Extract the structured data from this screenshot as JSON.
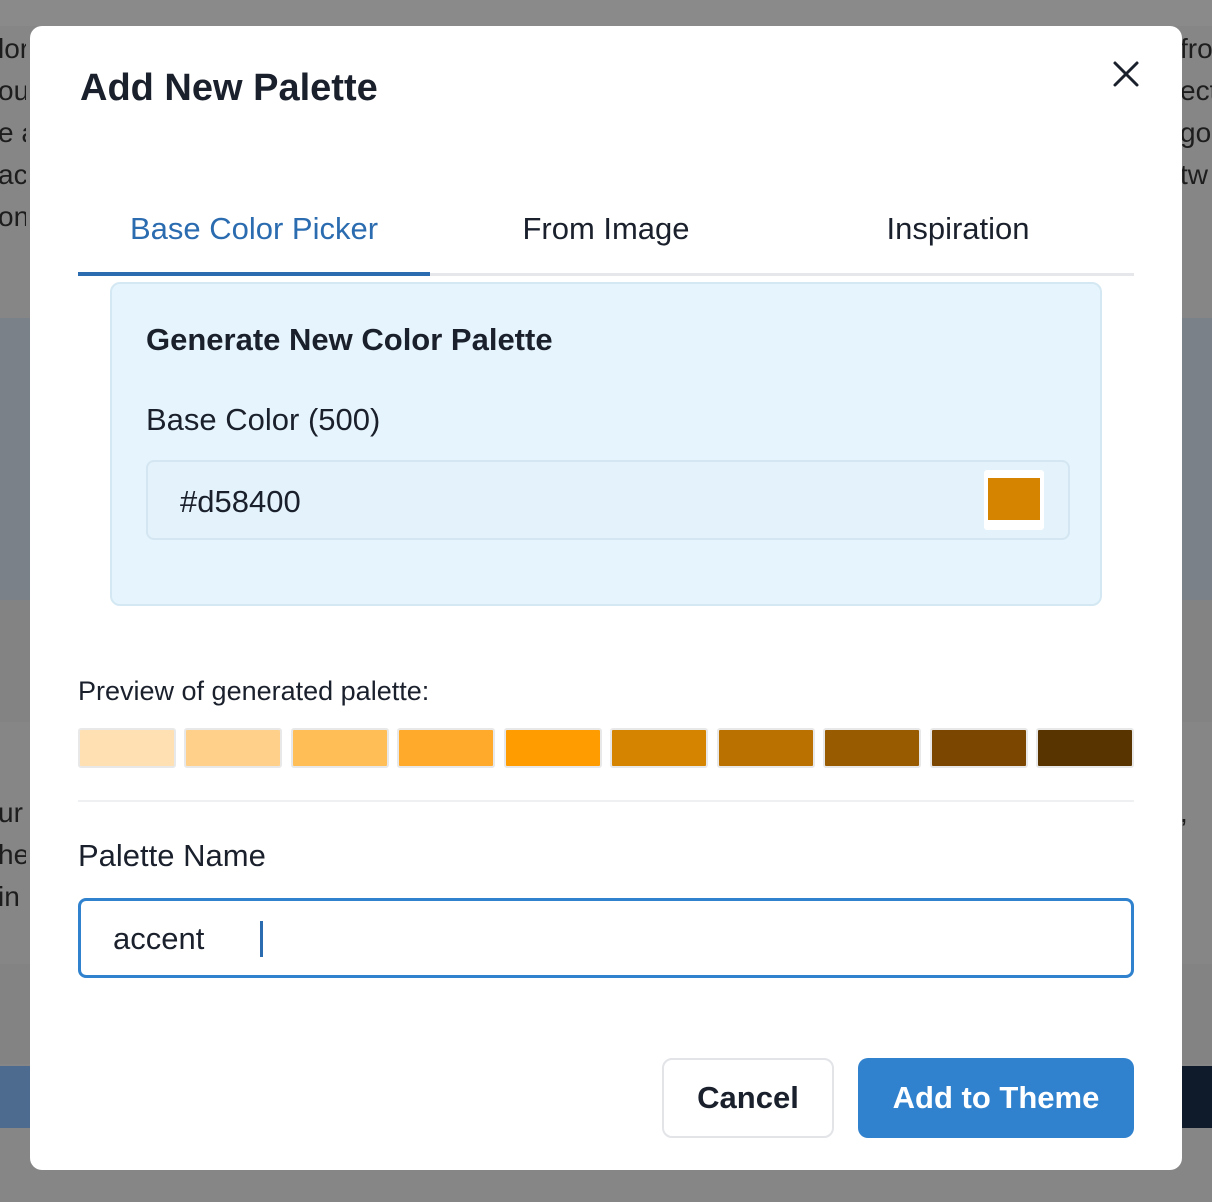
{
  "modal": {
    "title": "Add New Palette",
    "tabs": [
      {
        "label": "Base Color Picker",
        "active": true
      },
      {
        "label": "From Image",
        "active": false
      },
      {
        "label": "Inspiration",
        "active": false
      }
    ]
  },
  "generator": {
    "heading": "Generate New Color Palette",
    "base_color_label": "Base Color (500)",
    "base_color_value": "#d58400",
    "base_color_swatch": "#d58400"
  },
  "preview": {
    "label": "Preview of generated palette:",
    "swatches": [
      "#ffe0b2",
      "#ffd08a",
      "#ffbf56",
      "#ffaa2b",
      "#ff9c00",
      "#d58400",
      "#bb7100",
      "#985b00",
      "#7a4600",
      "#583400"
    ]
  },
  "palette_name": {
    "label": "Palette Name",
    "value": "accent"
  },
  "footer": {
    "cancel_label": "Cancel",
    "submit_label": "Add to Theme"
  },
  "background": {
    "left_fragments": [
      "lor",
      "ous",
      "e a",
      "act",
      "on",
      "ur t",
      "he",
      " in"
    ],
    "right_fragments": [
      "fro",
      "ect",
      "go",
      "tw",
      ","
    ]
  },
  "colors": {
    "accent": "#3182ce",
    "tab_active": "#2b6cb0",
    "panel_bg": "#e6f5fd"
  }
}
